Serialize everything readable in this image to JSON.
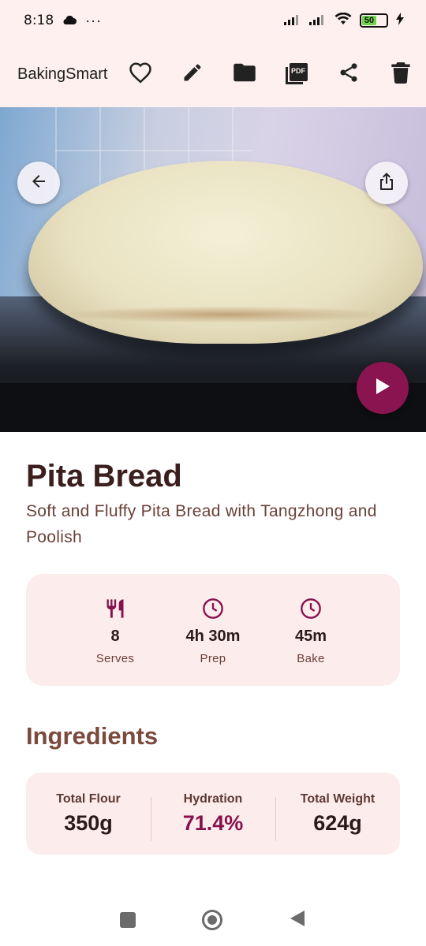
{
  "status": {
    "time": "8:18",
    "dots": "···",
    "battery": "50"
  },
  "appbar": {
    "brand": "BakingSmart",
    "actions": [
      "favorite-icon",
      "edit-icon",
      "folder-icon",
      "pdf-icon",
      "share-icon",
      "delete-icon"
    ],
    "pdf_label": "PDF"
  },
  "recipe": {
    "title": "Pita Bread",
    "subtitle": "Soft and Fluffy Pita Bread with Tangzhong and Poolish"
  },
  "stats": [
    {
      "icon": "cutlery-icon",
      "value": "8",
      "label": "Serves"
    },
    {
      "icon": "clock-icon",
      "value": "4h 30m",
      "label": "Prep"
    },
    {
      "icon": "clock-icon",
      "value": "45m",
      "label": "Bake"
    }
  ],
  "ingredients": {
    "heading": "Ingredients",
    "summary": [
      {
        "label": "Total Flour",
        "value": "350g"
      },
      {
        "label": "Hydration",
        "value": "71.4%"
      },
      {
        "label": "Total Weight",
        "value": "624g"
      }
    ]
  },
  "colors": {
    "accent": "#8a1450",
    "surface": "#fdecec",
    "appbar": "#fdf0ee"
  }
}
